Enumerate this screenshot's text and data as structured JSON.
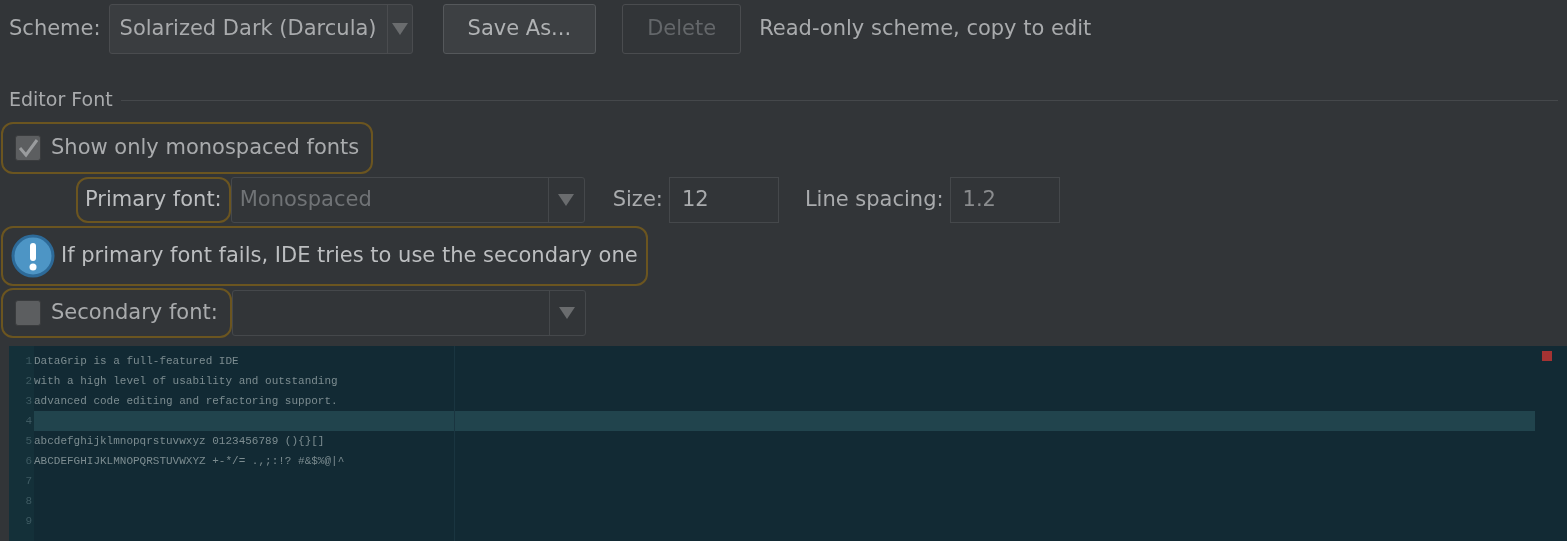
{
  "scheme": {
    "label": "Scheme:",
    "value": "Solarized Dark (Darcula)",
    "buttons": [
      {
        "label": "Save As...",
        "disabled": false
      },
      {
        "label": "Delete",
        "disabled": true
      }
    ],
    "note": "Read-only scheme, copy to edit"
  },
  "section": {
    "title": "Editor Font"
  },
  "show_monospaced": {
    "label": "Show only monospaced fonts",
    "checked": true
  },
  "primary_font": {
    "label": "Primary font:",
    "value": "Monospaced",
    "disabled": true
  },
  "size": {
    "label": "Size:",
    "value": "12"
  },
  "line_spacing": {
    "label": "Line spacing:",
    "value": "1.2"
  },
  "info": {
    "text": "If primary font fails, IDE tries to use the secondary one"
  },
  "secondary_font": {
    "label": "Secondary font:",
    "checked": false
  },
  "preview": {
    "lines": [
      {
        "number": "1",
        "text": "DataGrip is a full-featured IDE",
        "current": false
      },
      {
        "number": "2",
        "text": "with a high level of usability and outstanding",
        "current": false
      },
      {
        "number": "3",
        "text": "advanced code editing and refactoring support.",
        "current": false
      },
      {
        "number": "4",
        "current": true
      },
      {
        "number": "5",
        "text": "abcdefghijklmnopqrstuvwxyz 0123456789 (){}[]",
        "current": false
      },
      {
        "number": "6",
        "text": "ABCDEFGHIJKLMNOPQRSTUVWXYZ +-*/= .,;:!? #&$%@|^",
        "current": false
      },
      {
        "number": "7",
        "current": false
      },
      {
        "number": "8",
        "current": false
      },
      {
        "number": "9",
        "current": false
      }
    ]
  }
}
